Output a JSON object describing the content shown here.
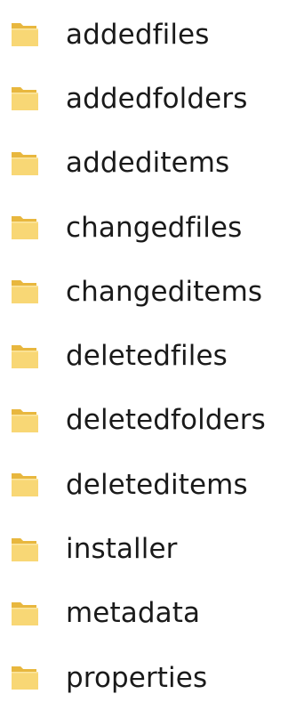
{
  "folders": [
    {
      "name": "addedfiles",
      "icon": "folder-icon"
    },
    {
      "name": "addedfolders",
      "icon": "folder-icon"
    },
    {
      "name": "addeditems",
      "icon": "folder-icon"
    },
    {
      "name": "changedfiles",
      "icon": "folder-icon"
    },
    {
      "name": "changeditems",
      "icon": "folder-icon"
    },
    {
      "name": "deletedfiles",
      "icon": "folder-icon"
    },
    {
      "name": "deletedfolders",
      "icon": "folder-icon"
    },
    {
      "name": "deleteditems",
      "icon": "folder-icon"
    },
    {
      "name": "installer",
      "icon": "folder-icon"
    },
    {
      "name": "metadata",
      "icon": "folder-icon"
    },
    {
      "name": "properties",
      "icon": "folder-icon"
    }
  ],
  "colors": {
    "folder_front": "#f8d775",
    "folder_back": "#e8b73e",
    "text": "#1a1a1a",
    "background": "#ffffff"
  }
}
